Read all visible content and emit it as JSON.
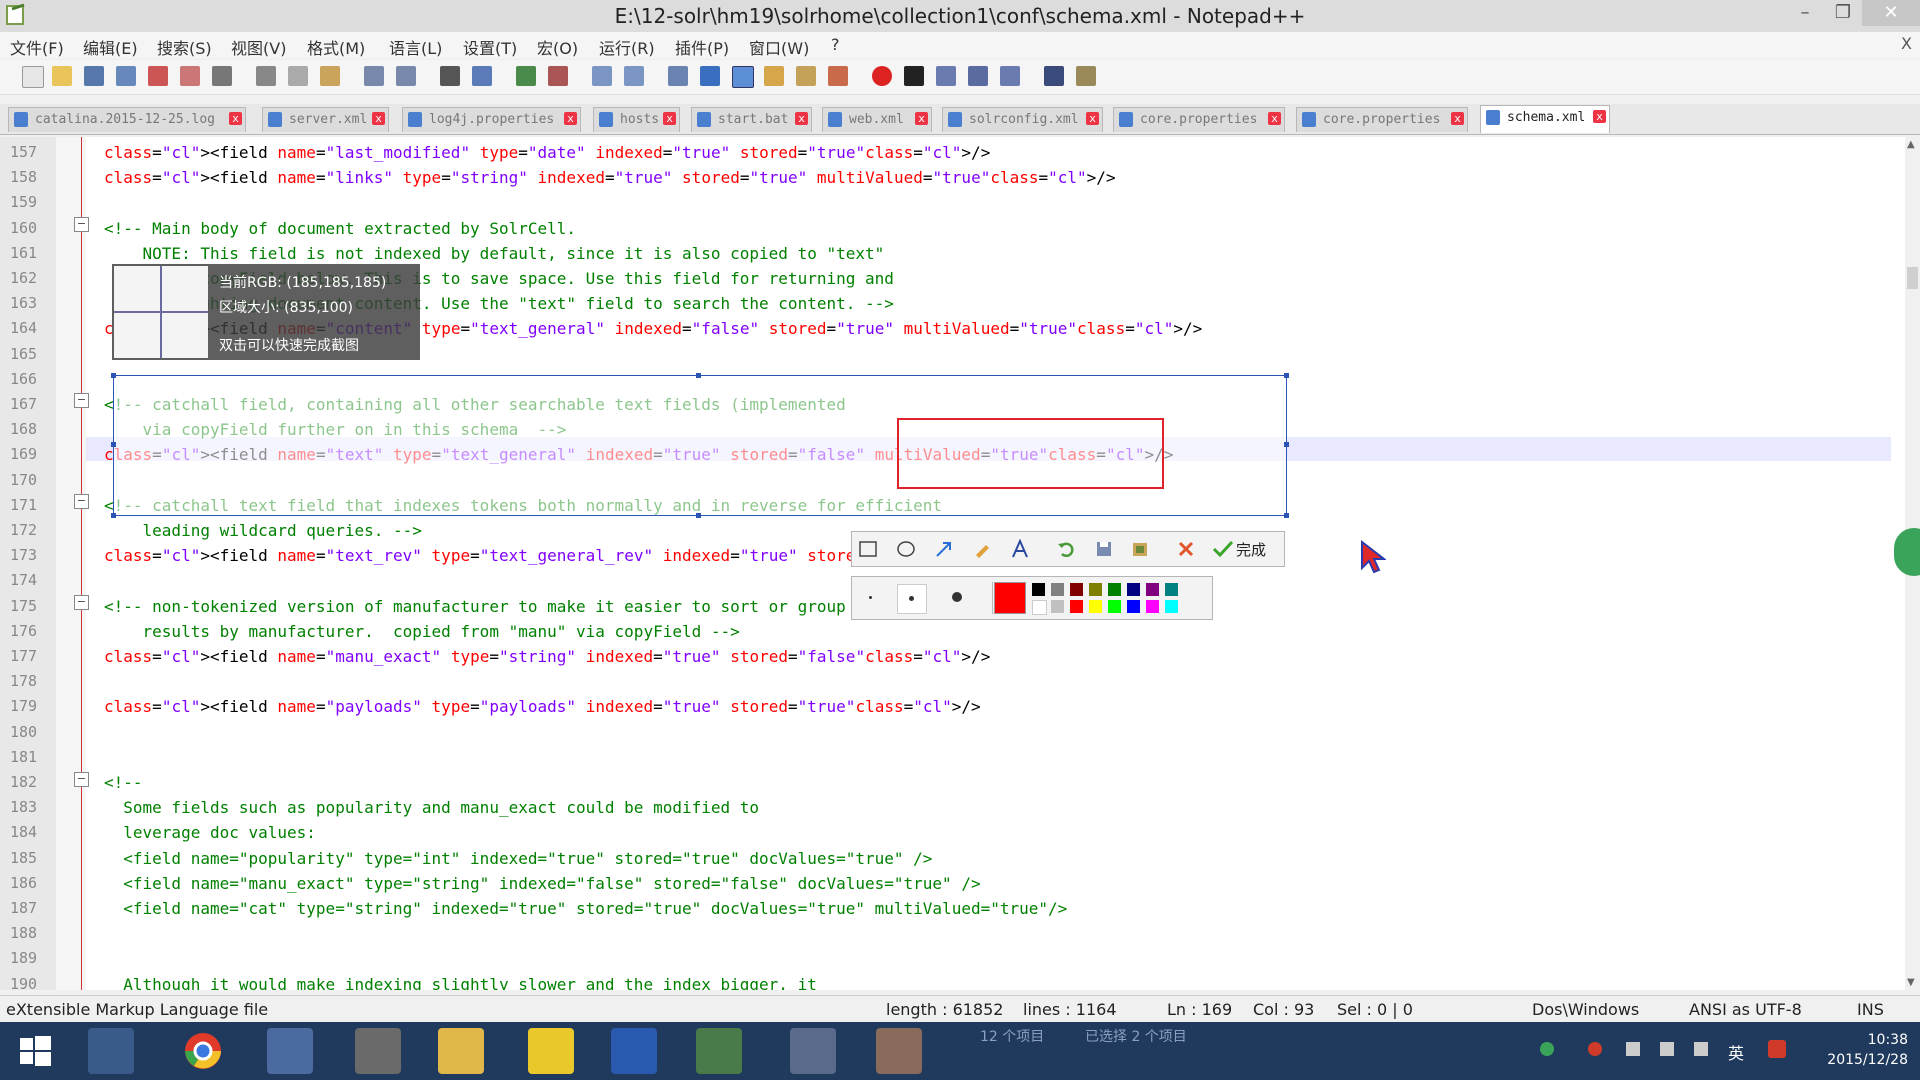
{
  "window": {
    "title": "E:\\12-solr\\hm19\\solrhome\\collection1\\conf\\schema.xml - Notepad++",
    "minimize": "–",
    "restore": "❐",
    "close": "✕"
  },
  "menu": {
    "items": [
      "文件(F)",
      "编辑(E)",
      "搜索(S)",
      "视图(V)",
      "格式(M)",
      "语言(L)",
      "设置(T)",
      "宏(O)",
      "运行(R)",
      "插件(P)",
      "窗口(W)",
      "?"
    ],
    "close": "X"
  },
  "tabs": [
    {
      "label": "catalina.2015-12-25.log",
      "active": false
    },
    {
      "label": "server.xml",
      "active": false
    },
    {
      "label": "log4j.properties",
      "active": false
    },
    {
      "label": "hosts",
      "active": false
    },
    {
      "label": "start.bat",
      "active": false
    },
    {
      "label": "web.xml",
      "active": false
    },
    {
      "label": "solrconfig.xml",
      "active": false
    },
    {
      "label": "core.properties",
      "active": false
    },
    {
      "label": "core.properties",
      "active": false
    },
    {
      "label": "schema.xml",
      "active": true
    }
  ],
  "editor": {
    "line_numbers": [
      "157",
      "158",
      "159",
      "160",
      "161",
      "162",
      "163",
      "164",
      "165",
      "166",
      "167",
      "168",
      "169",
      "170",
      "171",
      "172",
      "173",
      "174",
      "175",
      "176",
      "177",
      "178",
      "179",
      "180",
      "181",
      "182",
      "183",
      "184",
      "185",
      "186",
      "187",
      "188",
      "189",
      "190"
    ],
    "lines": [
      "<field name=\"last_modified\" type=\"date\" indexed=\"true\" stored=\"true\"/>",
      "<field name=\"links\" type=\"string\" indexed=\"true\" stored=\"true\" multiValued=\"true\"/>",
      "",
      "<!-- Main body of document extracted by SolrCell.",
      "    NOTE: This field is not indexed by default, since it is also copied to \"text\"",
      "    using copyField below. This is to save space. Use this field for returning and",
      "    highlighting document content. Use the \"text\" field to search the content. -->",
      "<field name=\"content\" type=\"text_general\" indexed=\"false\" stored=\"true\" multiValued=\"true\"/>",
      "",
      "",
      "<!-- catchall field, containing all other searchable text fields (implemented",
      "    via copyField further on in this schema  -->",
      "<field name=\"text\" type=\"text_general\" indexed=\"true\" stored=\"false\" multiValued=\"true\"/>",
      "",
      "<!-- catchall text field that indexes tokens both normally and in reverse for efficient",
      "    leading wildcard queries. -->",
      "<field name=\"text_rev\" type=\"text_general_rev\" indexed=\"true\" stored=\"false\" multiValued=\"true\"/>",
      "",
      "<!-- non-tokenized version of manufacturer to make it easier to sort or group",
      "    results by manufacturer.  copied from \"manu\" via copyField -->",
      "<field name=\"manu_exact\" type=\"string\" indexed=\"true\" stored=\"false\"/>",
      "",
      "<field name=\"payloads\" type=\"payloads\" indexed=\"true\" stored=\"true\"/>",
      "",
      "",
      "<!--",
      "  Some fields such as popularity and manu_exact could be modified to",
      "  leverage doc values:",
      "  <field name=\"popularity\" type=\"int\" indexed=\"true\" stored=\"true\" docValues=\"true\" />",
      "  <field name=\"manu_exact\" type=\"string\" indexed=\"false\" stored=\"false\" docValues=\"true\" />",
      "  <field name=\"cat\" type=\"string\" indexed=\"true\" stored=\"true\" docValues=\"true\" multiValued=\"true\"/>",
      "",
      "",
      "  Although it would make indexing slightly slower and the index bigger, it"
    ],
    "current_line": "169"
  },
  "capture_overlay": {
    "rgb_label": "当前RGB: (185,185,185)",
    "size_label": "区域大小: (835,100)",
    "hint": "双击可以快速完成截图",
    "done_label": "完成",
    "colors": [
      "#ff0000",
      "#000000",
      "#808080",
      "#800000",
      "#808000",
      "#008000",
      "#000080",
      "#800080",
      "#008080",
      "#ffffff",
      "#c0c0c0",
      "#ff0000",
      "#ffff00",
      "#00ff00",
      "#0000ff",
      "#ff00ff",
      "#00ffff"
    ]
  },
  "status": {
    "file_type": "eXtensible Markup Language file",
    "length": "length : 61852",
    "lines": "lines : 1164",
    "ln": "Ln : 169",
    "col": "Col : 93",
    "sel": "Sel : 0 | 0",
    "eol": "Dos\\Windows",
    "encoding": "ANSI as UTF-8",
    "mode": "INS"
  },
  "taskbar": {
    "time": "10:38",
    "date": "2015/12/28",
    "tray_ime": "英",
    "overlay_text_1": "12 个项目",
    "overlay_text_2": "已选择 2 个项目"
  }
}
